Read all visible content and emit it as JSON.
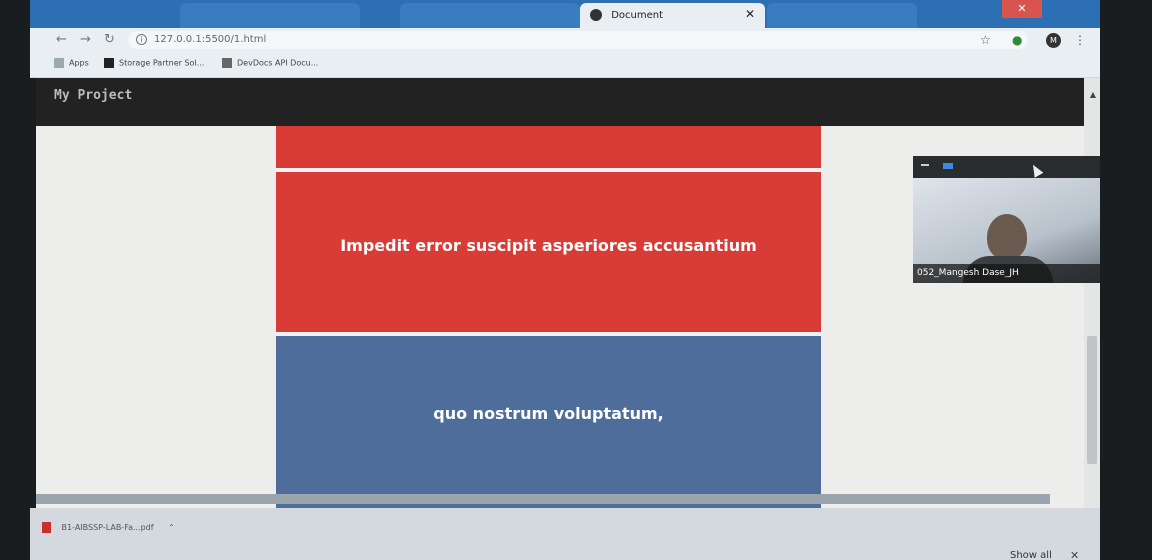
{
  "browser": {
    "tabs": [
      {
        "label": ""
      },
      {
        "label": ""
      },
      {
        "label": "Document"
      },
      {
        "label": ""
      }
    ],
    "address": "127.0.0.1:5500/1.html",
    "profile_initial": "M",
    "bookmarks": [
      {
        "label": "Apps"
      },
      {
        "label": "Storage Partner Sol..."
      },
      {
        "label": "DevDocs API Docu..."
      }
    ]
  },
  "page": {
    "brand": "My Project",
    "blocks": [
      {
        "text": ""
      },
      {
        "text": "Impedit error suscipit asperiores accusantium"
      },
      {
        "text": "quo nostrum voluptatum,"
      }
    ]
  },
  "video": {
    "participant": "052_Mangesh Dase_JH"
  },
  "downloads": {
    "file": "B1-AIBSSP-LAB-Fa...pdf",
    "show_all": "Show all"
  },
  "colors": {
    "red_block": "#d93b36",
    "blue_block": "#4f6d9b",
    "navbar": "#222222",
    "tabbar": "#2c6fb3"
  }
}
